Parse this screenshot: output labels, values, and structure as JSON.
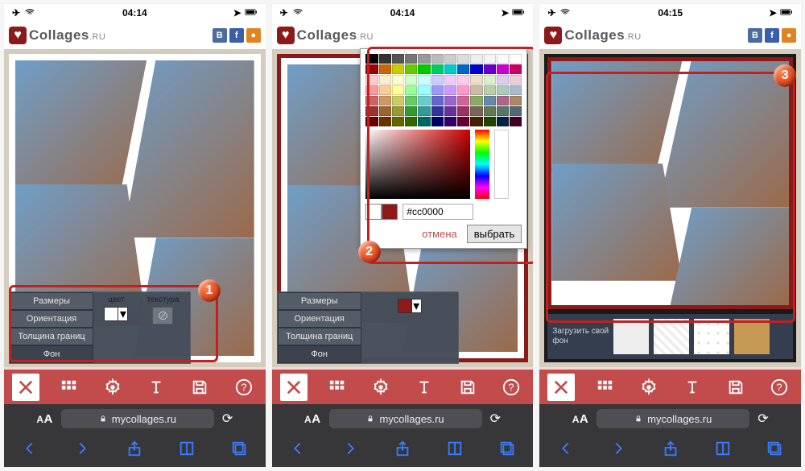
{
  "status": {
    "time1": "04:14",
    "time2": "04:14",
    "time3": "04:15"
  },
  "brand": {
    "name": "Collages",
    "tld": ".RU"
  },
  "social": {
    "vk": "B",
    "fb": "f",
    "ok": "●"
  },
  "menu": {
    "tabs": [
      "Размеры",
      "Ориентация",
      "Толщина границ",
      "Фон"
    ],
    "color_label": "цвет",
    "texture_label": "текстура"
  },
  "picker": {
    "hex": "#cc0000",
    "cancel": "отмена",
    "choose": "выбрать"
  },
  "strip": {
    "upload": "Загрузить свой фон"
  },
  "url": {
    "domain": "mycollages.ru",
    "aa": "A"
  },
  "badges": {
    "one": "1",
    "two": "2",
    "three": "3"
  }
}
